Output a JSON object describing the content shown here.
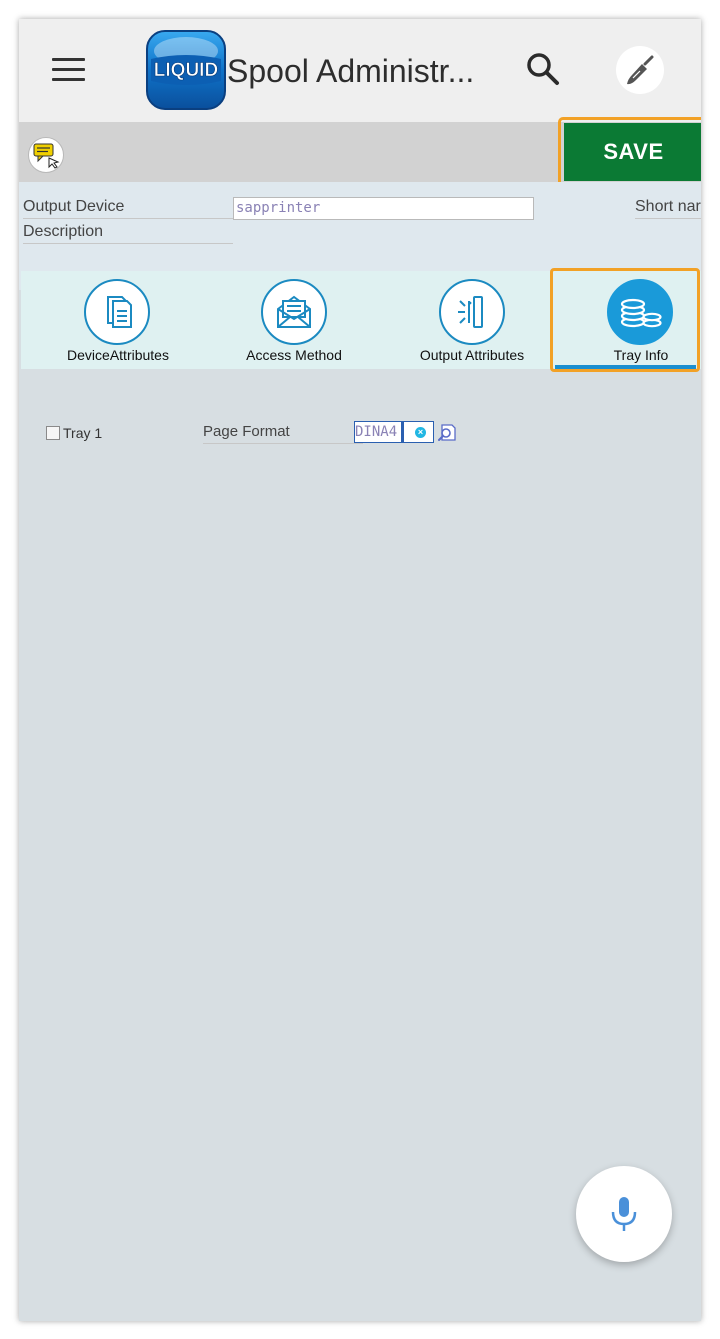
{
  "app_bar": {
    "title": "Spool Administr...",
    "logo_text": "LIQUID",
    "menu_icon": "hamburger-icon",
    "search_icon": "search-icon",
    "settings_icon": "brush-icon"
  },
  "toolbar": {
    "message_icon": "message-icon",
    "save_label": "SAVE"
  },
  "form": {
    "output_device_label": "Output Device",
    "output_device_value": "sapprinter",
    "description_label": "Description",
    "short_name_label": "Short nar"
  },
  "tabs": [
    {
      "label": "DeviceAttributes",
      "icon": "documents-icon",
      "active": false
    },
    {
      "label": "Access Method",
      "icon": "envelope-icon",
      "active": false
    },
    {
      "label": "Output Attributes",
      "icon": "output-icon",
      "active": false
    },
    {
      "label": "Tray Info",
      "icon": "coins-icon",
      "active": true
    }
  ],
  "tray": {
    "tray_label": "Tray 1",
    "checked": false,
    "page_format_label": "Page Format",
    "page_format_value": "DINA4"
  },
  "fab": {
    "icon": "microphone-icon"
  },
  "colors": {
    "save_button": "#0b7a34",
    "highlight": "#f2a126",
    "accent_blue": "#1a9ad9"
  }
}
